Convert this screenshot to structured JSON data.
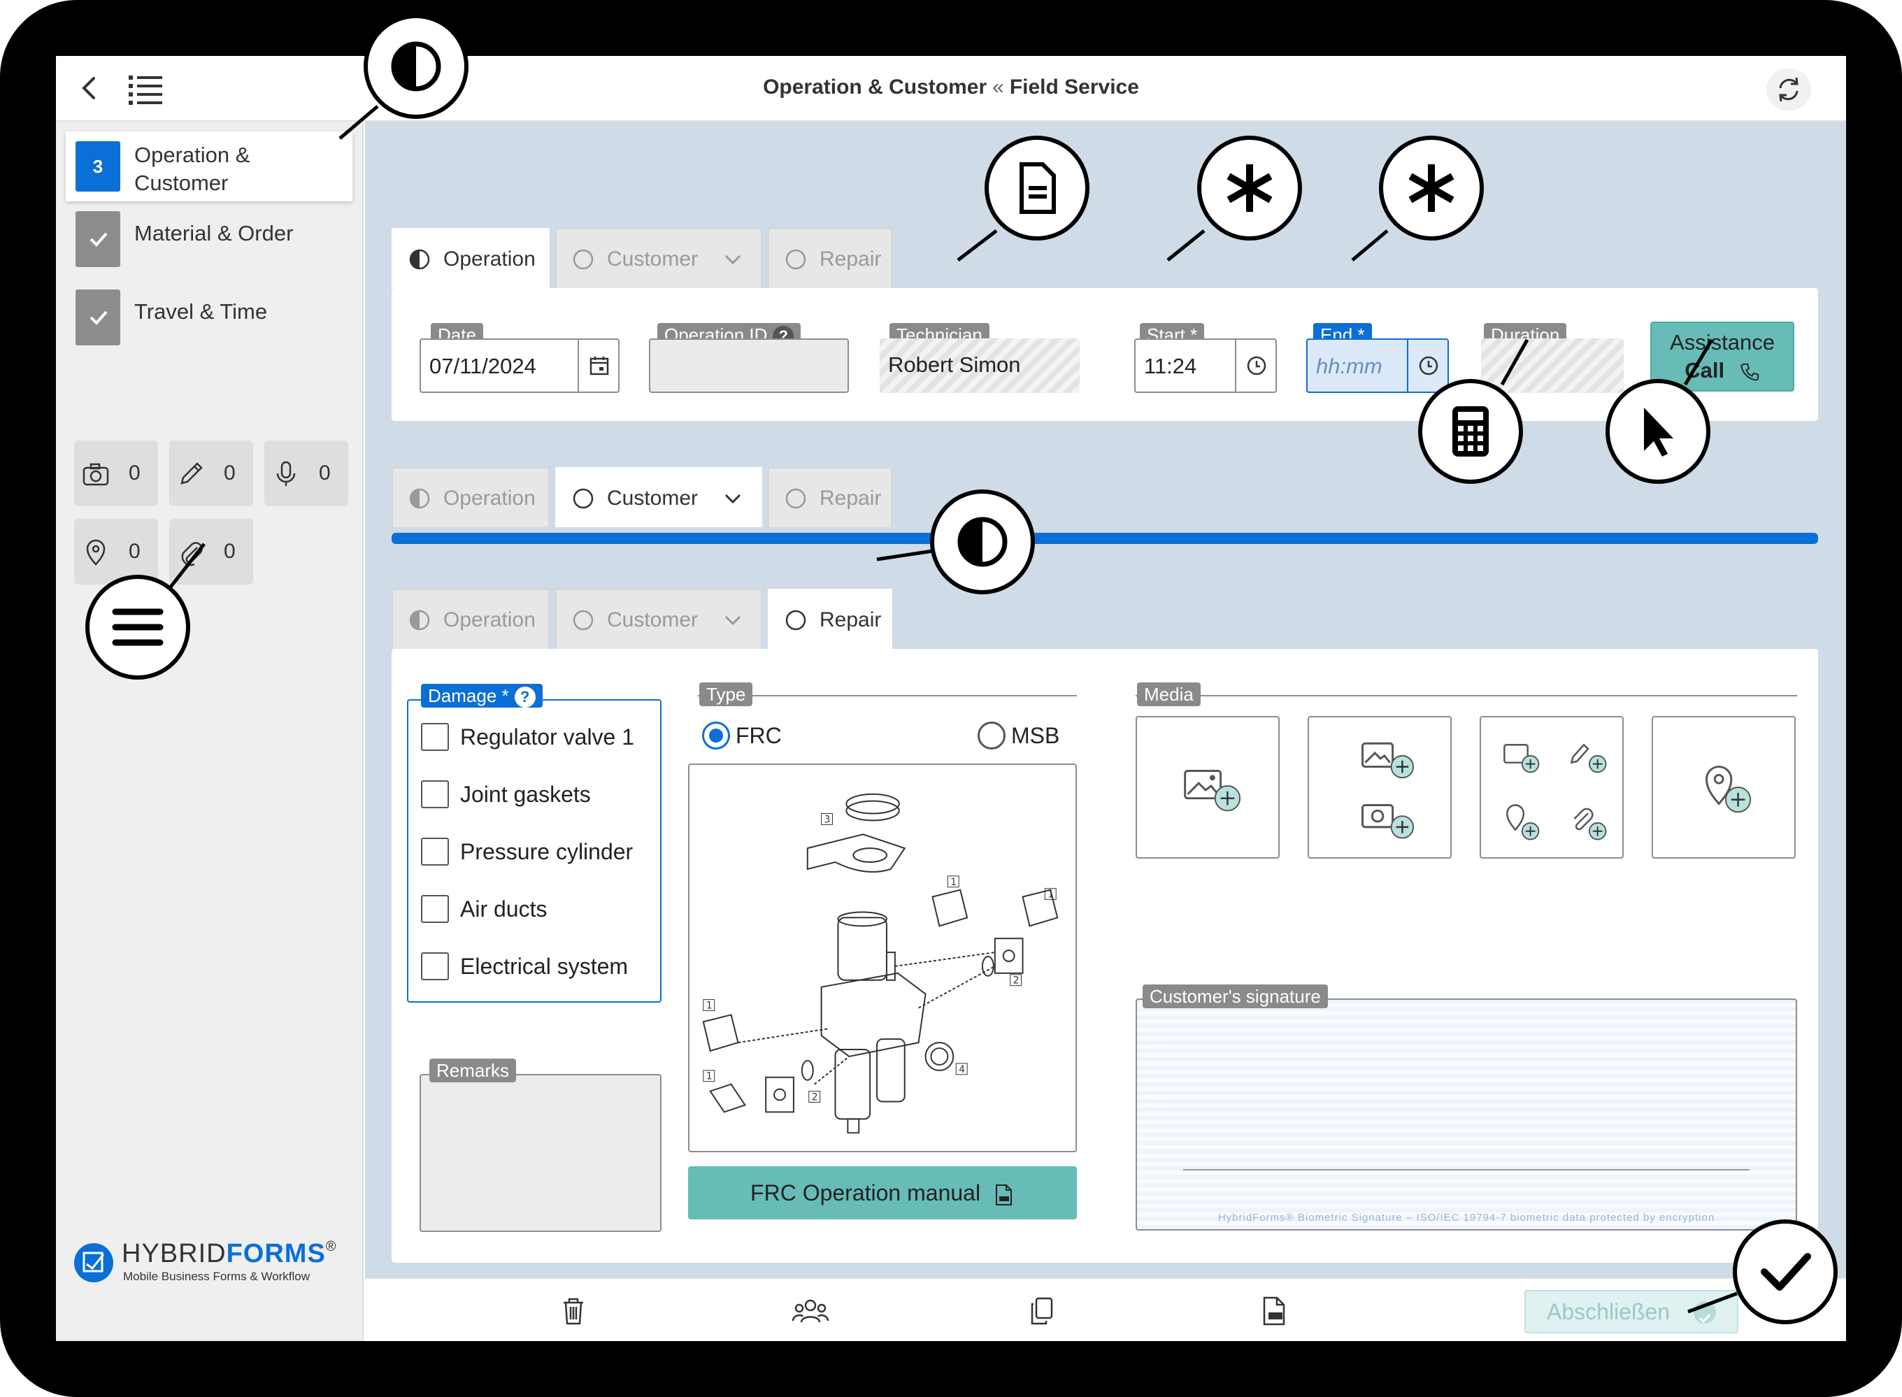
{
  "header": {
    "title_main": "Operation & Customer",
    "title_sep": "«",
    "title_parent": "Field Service"
  },
  "sidebar": {
    "items": [
      {
        "badge": "3",
        "label": "Operation & Customer",
        "state": "active"
      },
      {
        "label": "Material & Order",
        "state": "done"
      },
      {
        "label": "Travel & Time",
        "state": "done"
      }
    ],
    "counters": [
      {
        "icon": "camera-icon",
        "count": "0"
      },
      {
        "icon": "pencil-icon",
        "count": "0"
      },
      {
        "icon": "microphone-icon",
        "count": "0"
      },
      {
        "icon": "location-pin-icon",
        "count": "0"
      },
      {
        "icon": "paperclip-icon",
        "count": "0"
      }
    ],
    "logo": {
      "word1": "HYBRID",
      "word2": "FORMS",
      "reg": "®",
      "tagline": "Mobile Business Forms & Workflow"
    }
  },
  "tabs": {
    "operation": "Operation",
    "customer": "Customer",
    "repair": "Repair"
  },
  "operation_form": {
    "date": {
      "label": "Date",
      "value": "07/11/2024"
    },
    "operation_id": {
      "label": "Operation ID",
      "help": "?",
      "value": ""
    },
    "technician": {
      "label": "Technician",
      "value": "Robert Simon"
    },
    "start": {
      "label": "Start",
      "required": "*",
      "value": "11:24"
    },
    "end": {
      "label": "End",
      "required": "*",
      "placeholder": "hh:mm"
    },
    "duration": {
      "label": "Duration",
      "value": ""
    },
    "assistance": {
      "line1": "Assistance",
      "line2": "Call"
    }
  },
  "repair_form": {
    "damage": {
      "label": "Damage",
      "required": "*",
      "help": "?",
      "options": [
        "Regulator valve 1",
        "Joint gaskets",
        "Pressure cylinder",
        "Air ducts",
        "Electrical system"
      ]
    },
    "type": {
      "label": "Type",
      "options": [
        "FRC",
        "MSB"
      ],
      "selected": "FRC"
    },
    "diagram_labels": [
      "3",
      "1",
      "1",
      "2",
      "1",
      "1",
      "2",
      "4"
    ],
    "manual_button": "FRC Operation manual",
    "remarks": {
      "label": "Remarks",
      "value": ""
    },
    "media": {
      "label": "Media"
    },
    "signature": {
      "label": "Customer's signature",
      "footer": "HybridForms® Biometric Signature  –  ISO/IEC 19794-7 biometric data protected by encryption"
    }
  },
  "bottombar": {
    "finish_label": "Abschließen"
  },
  "colors": {
    "accent": "#0a6fd6",
    "teal": "#67bcb7",
    "main_bg": "#cfdbe7"
  }
}
